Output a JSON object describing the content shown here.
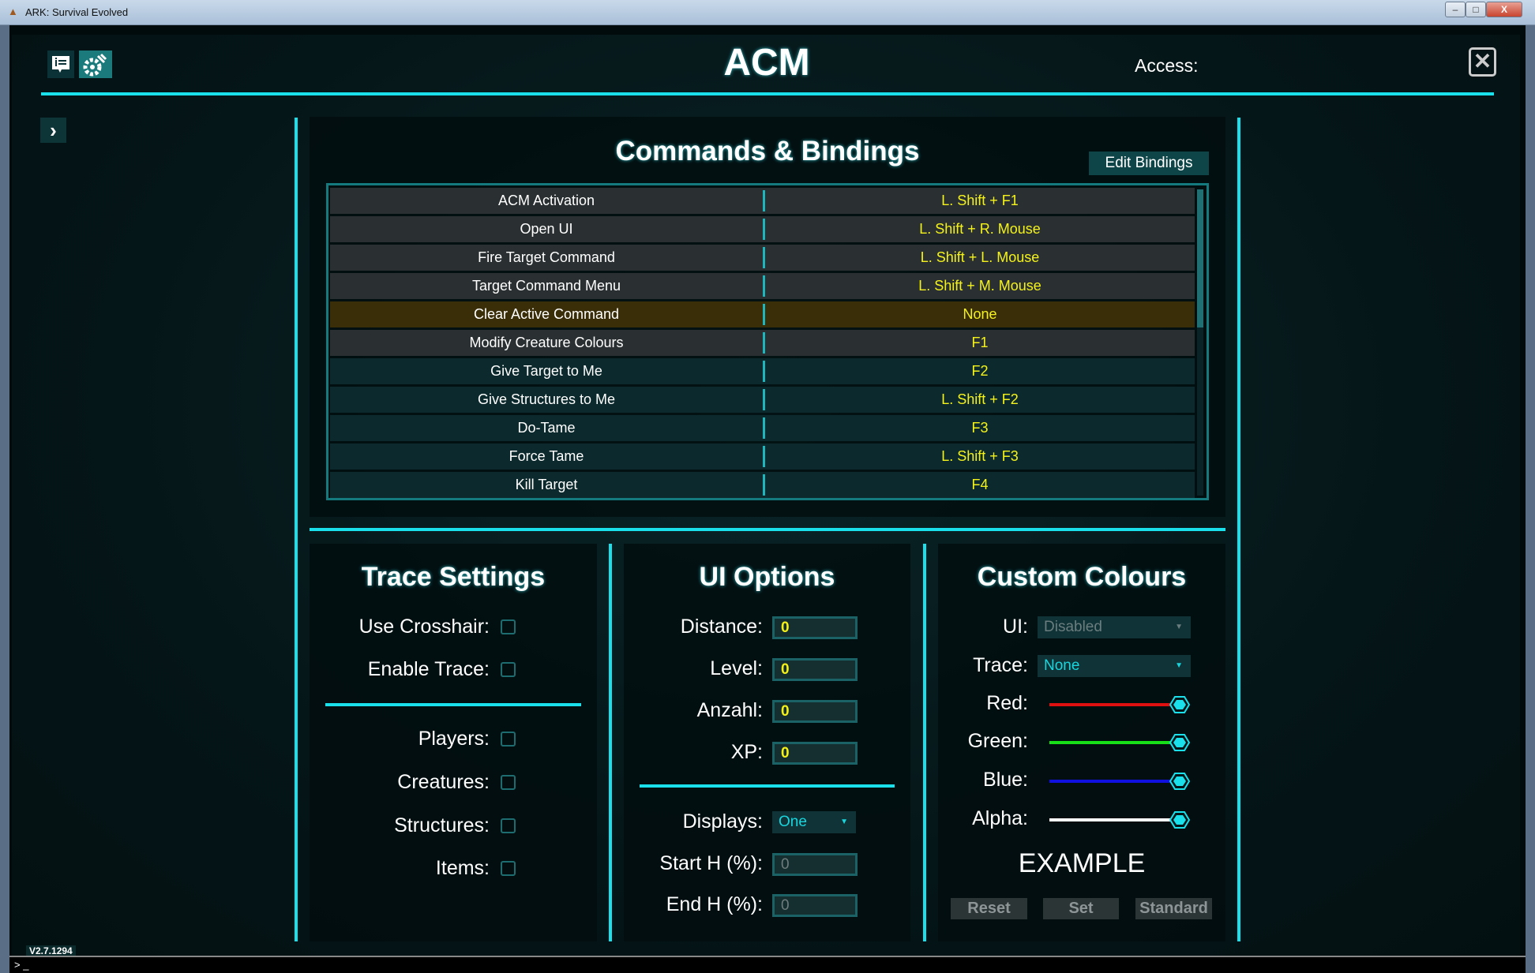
{
  "window": {
    "title": "ARK: Survival Evolved",
    "controls": [
      "minimize",
      "maximize",
      "close"
    ]
  },
  "header": {
    "title": "ACM",
    "access_label": "Access:",
    "icons": [
      "info-list-icon",
      "settings-gear-icon"
    ],
    "close_icon": "close-icon",
    "expand_icon": "chevron-right-icon"
  },
  "commands": {
    "title": "Commands & Bindings",
    "edit_button": "Edit Bindings",
    "selected_index": 4,
    "rows": [
      {
        "command": "ACM Activation",
        "binding": "L. Shift + F1"
      },
      {
        "command": "Open UI",
        "binding": "L. Shift + R. Mouse"
      },
      {
        "command": "Fire Target Command",
        "binding": "L. Shift + L. Mouse"
      },
      {
        "command": "Target Command Menu",
        "binding": "L. Shift + M. Mouse"
      },
      {
        "command": "Clear Active Command",
        "binding": "None"
      },
      {
        "command": "Modify Creature Colours",
        "binding": "F1"
      },
      {
        "command": "Give Target to Me",
        "binding": "F2"
      },
      {
        "command": "Give Structures to Me",
        "binding": "L. Shift + F2"
      },
      {
        "command": "Do-Tame",
        "binding": "F3"
      },
      {
        "command": "Force Tame",
        "binding": "L. Shift + F3"
      },
      {
        "command": "Kill Target",
        "binding": "F4"
      }
    ]
  },
  "trace": {
    "title": "Trace Settings",
    "options": [
      {
        "label": "Use Crosshair:",
        "checked": false
      },
      {
        "label": "Enable Trace:",
        "checked": false
      },
      {
        "label": "Players:",
        "checked": false
      },
      {
        "label": "Creatures:",
        "checked": false
      },
      {
        "label": "Structures:",
        "checked": false
      },
      {
        "label": "Items:",
        "checked": false
      }
    ]
  },
  "ui_options": {
    "title": "UI Options",
    "fields": [
      {
        "label": "Distance:",
        "value": "0"
      },
      {
        "label": "Level:",
        "value": "0"
      },
      {
        "label": "Anzahl:",
        "value": "0"
      },
      {
        "label": "XP:",
        "value": "0"
      }
    ],
    "displays_label": "Displays:",
    "displays_value": "One",
    "start_label": "Start H (%):",
    "start_value": "0",
    "end_label": "End H (%):",
    "end_value": "0"
  },
  "custom": {
    "title": "Custom Colours",
    "ui_label": "UI:",
    "ui_value": "Disabled",
    "trace_label": "Trace:",
    "trace_value": "None",
    "sliders": [
      {
        "label": "Red:",
        "color": "#e01010",
        "value": 1.0
      },
      {
        "label": "Green:",
        "color": "#18e018",
        "value": 1.0
      },
      {
        "label": "Blue:",
        "color": "#1010e0",
        "value": 1.0
      },
      {
        "label": "Alpha:",
        "color": "#ffffff",
        "value": 1.0
      }
    ],
    "example": "EXAMPLE",
    "buttons": [
      "Reset",
      "Set",
      "Standard"
    ]
  },
  "version": "V2.7.1294",
  "console": {
    "prompt": ">",
    "cursor": "_"
  },
  "colors": {
    "accent": "#19e0ea",
    "binding": "#f4f21a",
    "selected_row": "#3a2e08"
  }
}
